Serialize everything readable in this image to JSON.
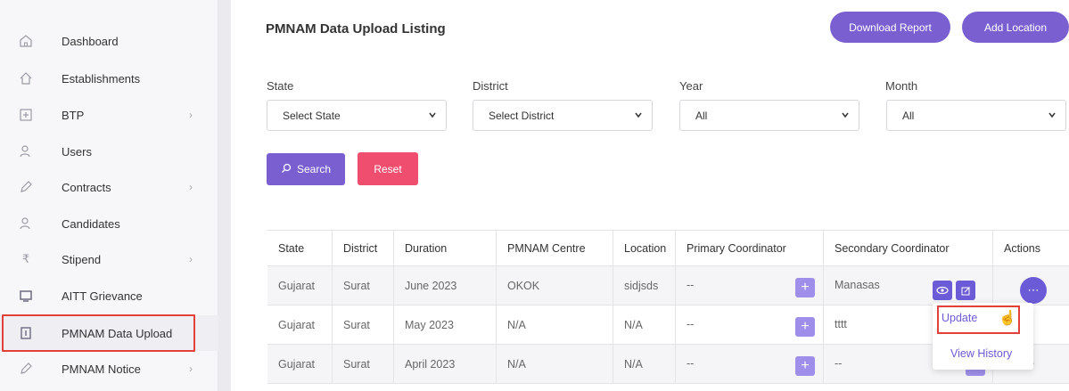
{
  "sidebar": {
    "items": [
      {
        "label": "Dashboard",
        "icon": "home-icon",
        "chevron": false
      },
      {
        "label": "Establishments",
        "icon": "house-outline-icon",
        "chevron": false
      },
      {
        "label": "BTP",
        "icon": "plus-square-icon",
        "chevron": true
      },
      {
        "label": "Users",
        "icon": "users-icon",
        "chevron": false
      },
      {
        "label": "Contracts",
        "icon": "pen-icon",
        "chevron": true
      },
      {
        "label": "Candidates",
        "icon": "users-icon",
        "chevron": false
      },
      {
        "label": "Stipend",
        "icon": "rupee-icon",
        "chevron": true
      },
      {
        "label": "AITT Grievance",
        "icon": "screen-icon",
        "chevron": false
      },
      {
        "label": "PMNAM Data Upload",
        "icon": "document-icon",
        "chevron": false,
        "active": true
      },
      {
        "label": "PMNAM Notice",
        "icon": "pen-icon",
        "chevron": true
      }
    ],
    "chevron_glyph": "›"
  },
  "header": {
    "title": "PMNAM Data Upload Listing",
    "download_label": "Download Report",
    "add_label": "Add Location"
  },
  "filters": {
    "state": {
      "label": "State",
      "value": "Select State"
    },
    "district": {
      "label": "District",
      "value": "Select District"
    },
    "year": {
      "label": "Year",
      "value": "All"
    },
    "month": {
      "label": "Month",
      "value": "All"
    }
  },
  "actions": {
    "search_label": "Search",
    "reset_label": "Reset"
  },
  "table": {
    "headers": [
      "State",
      "District",
      "Duration",
      "PMNAM Centre",
      "Location",
      "Primary Coordinator",
      "Secondary Coordinator",
      "Actions"
    ],
    "rows": [
      {
        "state": "Gujarat",
        "district": "Surat",
        "duration": "June 2023",
        "centre": "OKOK",
        "location": "sidjsds",
        "primary": "--",
        "secondary": "Manasas"
      },
      {
        "state": "Gujarat",
        "district": "Surat",
        "duration": "May 2023",
        "centre": "N/A",
        "location": "N/A",
        "primary": "--",
        "secondary": "tttt"
      },
      {
        "state": "Gujarat",
        "district": "Surat",
        "duration": "April 2023",
        "centre": "N/A",
        "location": "N/A",
        "primary": "--",
        "secondary": "--"
      }
    ]
  },
  "row_menu": {
    "update_label": "Update",
    "history_label": "View History"
  },
  "colors": {
    "primary": "#7a5fd0",
    "danger": "#f04e6e",
    "highlight": "#e2403b"
  }
}
